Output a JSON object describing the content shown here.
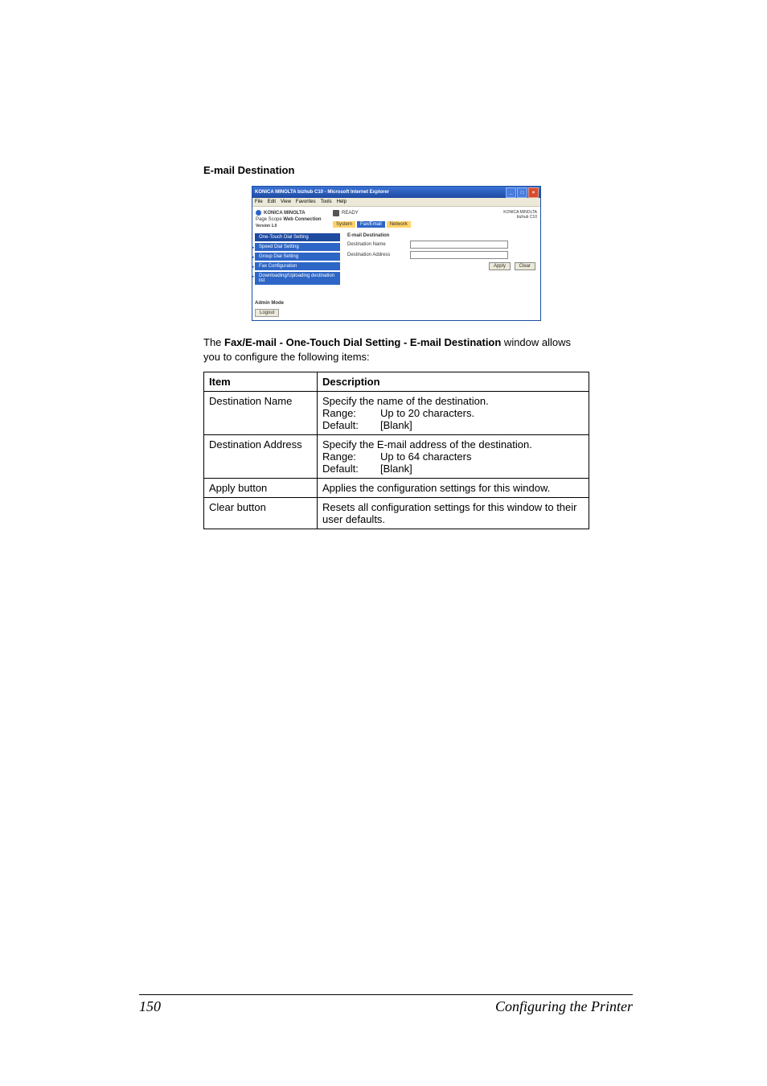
{
  "heading": "E-mail Destination",
  "screenshot": {
    "titlebar": "KONICA MINOLTA bizhub C10 - Microsoft Internet Explorer",
    "menus": [
      "File",
      "Edit",
      "View",
      "Favorites",
      "Tools",
      "Help"
    ],
    "brand_logo_text": "KONICA MINOLTA",
    "subbrand_prefix": "Page Scope",
    "subbrand_label": "Web Connection",
    "version_label": "Version 1.0",
    "status_text": "READY",
    "model_line1": "KONICA MINOLTA",
    "model_line2": "bizhub C10",
    "tabs": {
      "system": "System",
      "faxemail": "Fax/Email",
      "network": "Network"
    },
    "sidebar": {
      "items": [
        "One-Touch Dial Setting",
        "Speed Dial Setting",
        "Group Dial Setting",
        "Fax Configuration",
        "Downloading/Uploading destination list"
      ]
    },
    "admin_mode_label": "Admin Mode",
    "logout_label": "Logout",
    "form": {
      "title": "E-mail Destination",
      "row1_label": "Destination Name",
      "row2_label": "Destination Address",
      "apply_label": "Apply",
      "clear_label": "Clear"
    }
  },
  "paragraph": {
    "prefix": "The ",
    "bold": "Fax/E-mail - One-Touch Dial Setting - E-mail Destination",
    "suffix": " window allows you to configure the following items:"
  },
  "table": {
    "headers": {
      "item": "Item",
      "desc": "Description"
    },
    "rows": [
      {
        "item": "Destination Name",
        "desc_line": "Specify the name of the destination.",
        "range_label": "Range:",
        "range_val": "Up to 20 characters.",
        "default_label": "Default:",
        "default_val": "[Blank]"
      },
      {
        "item": "Destination Address",
        "desc_line": "Specify the E-mail address of the destination.",
        "range_label": "Range:",
        "range_val": "Up to 64 characters",
        "default_label": "Default:",
        "default_val": "[Blank]"
      },
      {
        "item": "Apply button",
        "desc_line": "Applies the configuration settings for this window."
      },
      {
        "item": "Clear button",
        "desc_line": "Resets all configuration settings for this window to their user defaults."
      }
    ]
  },
  "footer": {
    "page_number": "150",
    "section": "Configuring the Printer"
  }
}
